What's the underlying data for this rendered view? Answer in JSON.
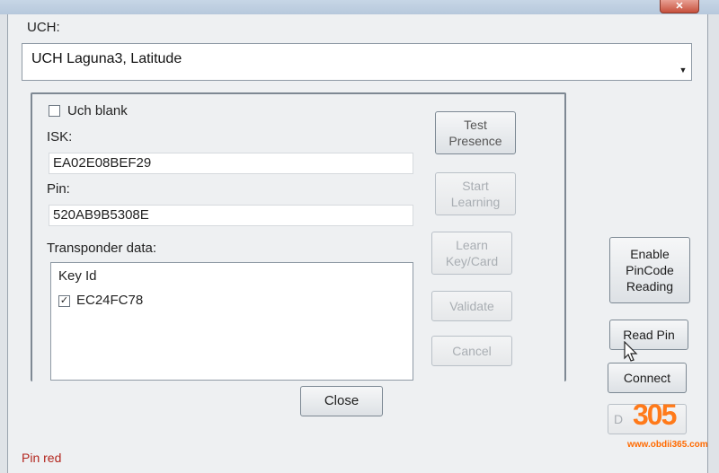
{
  "window": {
    "close_symbol": "✕"
  },
  "uch": {
    "label": "UCH:",
    "selected": "UCH Laguna3, Latitude"
  },
  "panel": {
    "uch_blank_label": "Uch blank",
    "isk_label": "ISK:",
    "isk_value": "EA02E08BEF29",
    "pin_label": "Pin:",
    "pin_value": "520AB9B5308E",
    "transponder_label": "Transponder data:",
    "list_header": "Key Id",
    "list_items": [
      {
        "label": "EC24FC78",
        "checked": true
      }
    ]
  },
  "buttons": {
    "test_presence": "Test\nPresence",
    "start_learning": "Start\nLearning",
    "learn_key_card": "Learn\nKey/Card",
    "validate": "Validate",
    "cancel": "Cancel",
    "close": "Close",
    "enable_pincode": "Enable\nPinCode\nReading",
    "read_pin": "Read Pin",
    "connect": "Connect",
    "partial": "D"
  },
  "status": {
    "text": "Pin red"
  },
  "watermark": {
    "number": "305",
    "url": "www.obdii365.com"
  },
  "colors": {
    "status_text": "#b3261e",
    "logo": "#ff7a1a"
  }
}
